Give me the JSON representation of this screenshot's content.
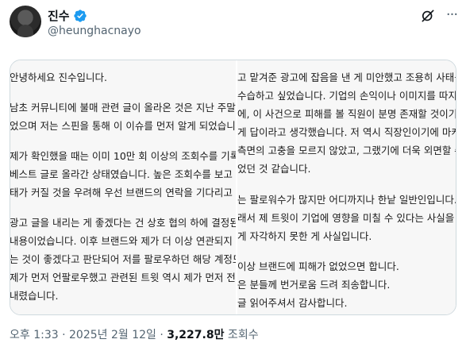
{
  "author": {
    "display_name": "진수",
    "handle": "@heunghacnayo",
    "verified": true,
    "verified_color": "#1d9bf0"
  },
  "icons": {
    "grok": "grok-icon",
    "more": "more-icon",
    "verified": "verified-badge-icon"
  },
  "image_left_lines": [
    "안녕하세요 진수입니다.",
    "남초 커뮤니티에 불매 관련 글이 올라온 것은 지난 주말이",
    "었으며 저는 스핀을 통해 이 이슈를 먼저 알게 되었습니다",
    "제가 확인했을 때는 이미 10만 회 이상의 조회수를 기록하",
    "베스트 글로 올라간 상태였습니다. 높은 조회수를 보고 사",
    "태가 커질 것을 우려해 우선 브랜드의 연락을 기다리고 있",
    "광고 글을 내리는 게 좋겠다는 건 상호 협의 하에 결정된",
    "내용이었습니다. 이후 브랜드와 제가 더 이상 연관되지 않",
    "는 것이 좋겠다고 판단되어 저를 팔로우하던 해당 계정도",
    "제가 먼저 언팔로우했고 관련된 트윗 역시 제가 먼저 전부",
    "내렸습니다."
  ],
  "image_right_lines": [
    "고 맡겨준 광고에 잡음을 낸 게 미안했고 조용히 사태를",
    "수습하고 싶었습니다. 기업의 손익이나 이미지를 따지기",
    "에, 이 사건으로 피해를 볼 직원이 분명 존재할 것이기에",
    "게 답이라고 생각했습니다. 저 역시 직장인이기에 마케",
    "측면의 고충을 모르지 않았고, 그랬기에 더욱 외면할 수",
    "었던 것 같습니다.",
    "는 팔로워수가 많지만 어디까지나 한낱 일반인입니다.",
    "래서 제 트윗이 기업에 영향을 미칠 수 있다는 사실을 깊",
    "게 자각하지 못한 게 사실입니다.",
    "이상 브랜드에 피해가 없었으면 합니다.",
    "은 분들께 번거로움 드려 죄송합니다.",
    "글 읽어주셔서 감사합니다."
  ],
  "meta": {
    "timestamp": "오후 1:33 · 2025년 2월 12일 · ",
    "views_count": "3,227.8만",
    "views_label": " 조회수"
  }
}
